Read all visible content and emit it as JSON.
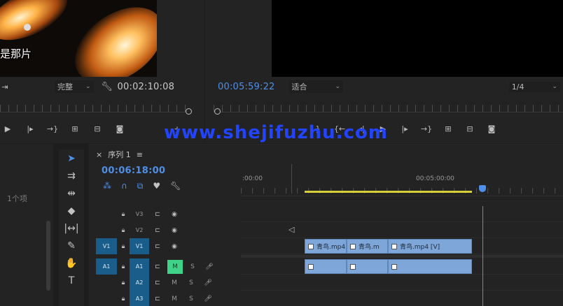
{
  "source_monitor": {
    "subtitle": "是那片",
    "fit_dropdown": "完整",
    "timecode": "00:02:10:08"
  },
  "program_monitor": {
    "timecode": "00:05:59:22",
    "fit_dropdown": "适合",
    "resolution_dropdown": "1/4"
  },
  "project_panel": {
    "item_count": "1个项"
  },
  "timeline": {
    "tab_label": "序列 1",
    "tab_menu": "≡",
    "close_glyph": "×",
    "timecode": "00:06:18:00",
    "ruler_labels": [
      ":00:00",
      "00:05:00:00"
    ],
    "tracks": [
      {
        "name": "V3",
        "source": ""
      },
      {
        "name": "V2",
        "source": ""
      },
      {
        "name": "V1",
        "source": "V1"
      },
      {
        "name": "A1",
        "source": "A1"
      },
      {
        "name": "A2",
        "source": ""
      },
      {
        "name": "A3",
        "source": ""
      }
    ],
    "clips": {
      "v1a": "青鸟.mp4",
      "v1b": "青鸟.m",
      "v1c": "青鸟.mp4 [V]"
    },
    "mute_label": "M",
    "solo_label": "S"
  },
  "watermark": "www.shejifuzhu.com",
  "colors": {
    "accent": "#4f8fe8",
    "clip": "#7ea6d8",
    "work_area": "#d6cf3a",
    "track_target": "#1b5d8a",
    "mute_on": "#3fd38a",
    "watermark": "#2244ff"
  }
}
